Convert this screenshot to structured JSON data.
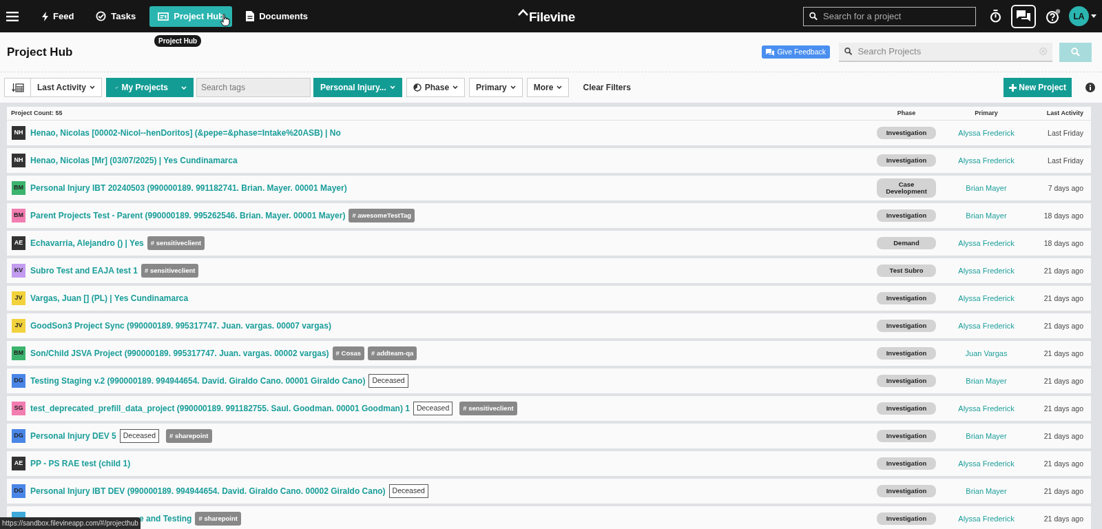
{
  "nav": {
    "items": [
      {
        "label": "Feed",
        "selected": false
      },
      {
        "label": "Tasks",
        "selected": false
      },
      {
        "label": "Project Hub",
        "selected": true
      },
      {
        "label": "Documents",
        "selected": false
      }
    ],
    "tooltip": "Project Hub",
    "logo": "Filevine",
    "search": {
      "placeholder": "Search for a project"
    },
    "avatar": "LA"
  },
  "header": {
    "title": "Project Hub",
    "feedback": "Give Feedback",
    "search": {
      "placeholder": "Search Projects"
    }
  },
  "toolbar": {
    "sort": "Last Activity",
    "my_projects": "My Projects",
    "tags": {
      "placeholder": "Search tags"
    },
    "project_type": "Personal Injury...",
    "filters": [
      "Phase",
      "Primary",
      "More"
    ],
    "clear": "Clear Filters",
    "new_project": "New Project"
  },
  "table": {
    "count": "Project Count: 55",
    "columns": [
      "Phase",
      "Primary",
      "Last Activity"
    ],
    "rows": [
      {
        "initials": "NH",
        "color": "#333333",
        "title": "Henao, Nicolas [00002-Nicol--henDoritos] (&pepe=&phase=Intake%20ASB) | No",
        "labels": [],
        "phase": "Investigation",
        "primary": "Alyssa Frederick",
        "last_activity": "Last Friday"
      },
      {
        "initials": "NH",
        "color": "#333333",
        "title": "Henao, Nicolas [Mr] (03/07/2025) | Yes Cundinamarca",
        "labels": [],
        "phase": "Investigation",
        "primary": "Alyssa Frederick",
        "last_activity": "Last Friday"
      },
      {
        "initials": "BM",
        "color": "#3cb46e",
        "title": "Personal Injury IBT 20240503 (990000189. 991182741. Brian. Mayer. 00001 Mayer)",
        "labels": [],
        "phase": "Case Development",
        "primary": "Brian Mayer",
        "last_activity": "7 days ago"
      },
      {
        "initials": "BM",
        "color": "#f27db0",
        "title": "Parent Projects Test - Parent (990000189. 995262546. Brian. Mayer. 00001 Mayer)",
        "labels": [
          {
            "kind": "tag",
            "text": "# awesomeTestTag"
          }
        ],
        "phase": "Investigation",
        "primary": "Brian Mayer",
        "last_activity": "18 days ago"
      },
      {
        "initials": "AE",
        "color": "#333333",
        "title": "Echavarria, Alejandro () | Yes",
        "labels": [
          {
            "kind": "tag",
            "text": "# sensitiveclient"
          }
        ],
        "phase": "Demand",
        "primary": "Alyssa Frederick",
        "last_activity": "18 days ago"
      },
      {
        "initials": "KV",
        "color": "#c39cf0",
        "title": "Subro Test and EAJA test 1",
        "labels": [
          {
            "kind": "tag",
            "text": "# sensitiveclient"
          }
        ],
        "phase": "Test Subro",
        "primary": "Alyssa Frederick",
        "last_activity": "21 days ago"
      },
      {
        "initials": "JV",
        "color": "#f2d23c",
        "title": "Vargas, Juan [] (PL) | Yes Cundinamarca",
        "labels": [],
        "phase": "Investigation",
        "primary": "Alyssa Frederick",
        "last_activity": "21 days ago"
      },
      {
        "initials": "JV",
        "color": "#f2d23c",
        "title": "GoodSon3 Project Sync (990000189. 995317747. Juan. vargas. 00007 vargas)",
        "labels": [],
        "phase": "Investigation",
        "primary": "Alyssa Frederick",
        "last_activity": "21 days ago"
      },
      {
        "initials": "BM",
        "color": "#3cb46e",
        "title": "Son/Child JSVA Project (990000189. 995317747. Juan. vargas. 00002 vargas)",
        "labels": [
          {
            "kind": "tag",
            "text": "# Cosas"
          },
          {
            "kind": "tag",
            "text": "# addteam-qa"
          }
        ],
        "phase": "Investigation",
        "primary": "Juan Vargas",
        "last_activity": "21 days ago"
      },
      {
        "initials": "DG",
        "color": "#4a86e8",
        "title": "Testing Staging v.2 (990000189. 994944654. David. Giraldo Cano. 00001 Giraldo Cano)",
        "labels": [
          {
            "kind": "status",
            "text": "Deceased"
          }
        ],
        "phase": "Investigation",
        "primary": "Brian Mayer",
        "last_activity": "21 days ago"
      },
      {
        "initials": "SG",
        "color": "#f27db0",
        "title": "test_deprecated_prefill_data_project (990000189. 991182755. Saul. Goodman. 00001 Goodman) 1",
        "labels": [
          {
            "kind": "status",
            "text": "Deceased"
          },
          {
            "kind": "tag",
            "text": "# sensitiveclient"
          }
        ],
        "phase": "Investigation",
        "primary": "Alyssa Frederick",
        "last_activity": "21 days ago"
      },
      {
        "initials": "DG",
        "color": "#4a86e8",
        "title": "Personal Injury DEV 5",
        "labels": [
          {
            "kind": "status",
            "text": "Deceased"
          },
          {
            "kind": "tag",
            "text": "# sharepoint"
          }
        ],
        "phase": "Investigation",
        "primary": "Brian Mayer",
        "last_activity": "21 days ago"
      },
      {
        "initials": "AE",
        "color": "#333333",
        "title": "PP - PS RAE test (child 1)",
        "labels": [],
        "phase": "Investigation",
        "primary": "Alyssa Frederick",
        "last_activity": "21 days ago"
      },
      {
        "initials": "DG",
        "color": "#4a86e8",
        "title": "Personal Injury IBT DEV (990000189. 994944654. David. Giraldo Cano. 00002 Giraldo Cano)",
        "labels": [
          {
            "kind": "status",
            "text": "Deceased"
          }
        ],
        "phase": "Investigation",
        "primary": "Brian Mayer",
        "last_activity": "21 days ago"
      },
      {
        "color": "#3fa9d9",
        "title": "e and Testing",
        "labels": [
          {
            "kind": "tag",
            "text": "# sharepoint"
          }
        ],
        "phase": "Investigation",
        "primary": "Alyssa Frederick",
        "last_activity": "21 days ago"
      }
    ]
  },
  "status_url": "https://sandbox.filevineapp.com/#/projecthub"
}
